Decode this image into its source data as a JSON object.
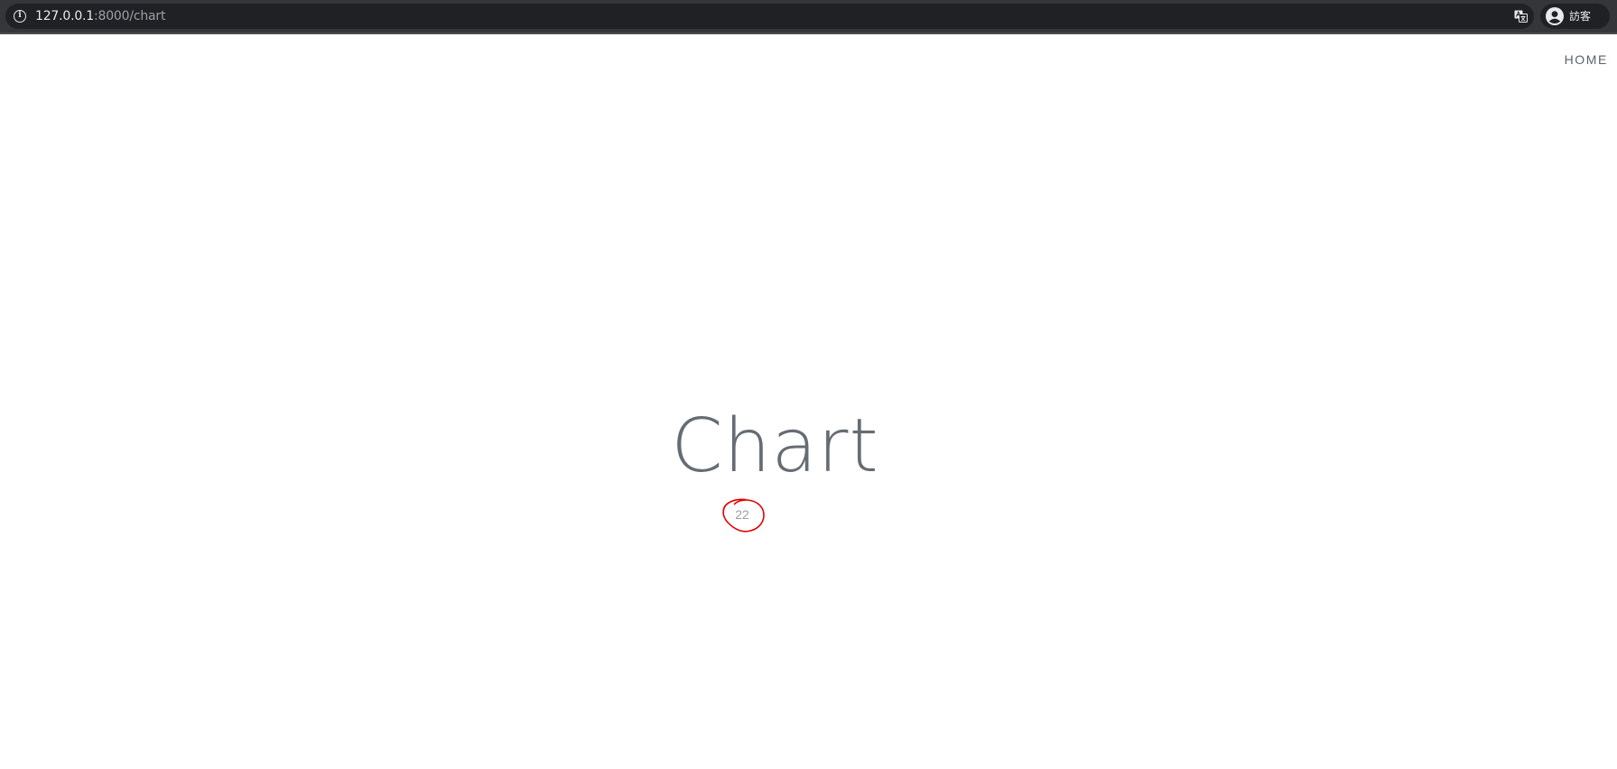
{
  "browser": {
    "url_host": "127.0.0.1",
    "url_rest": ":8000/chart",
    "profile_label": "訪客",
    "icons": {
      "site_info": "info-icon",
      "translate": "translate-icon",
      "profile": "avatar-icon"
    }
  },
  "nav": {
    "home_label": "HOME"
  },
  "main": {
    "title": "Chart",
    "count": "22"
  },
  "colors": {
    "browser_bar": "#35363a",
    "omnibox": "#202124",
    "title_text": "#666c73",
    "annotation": "#e00000"
  }
}
